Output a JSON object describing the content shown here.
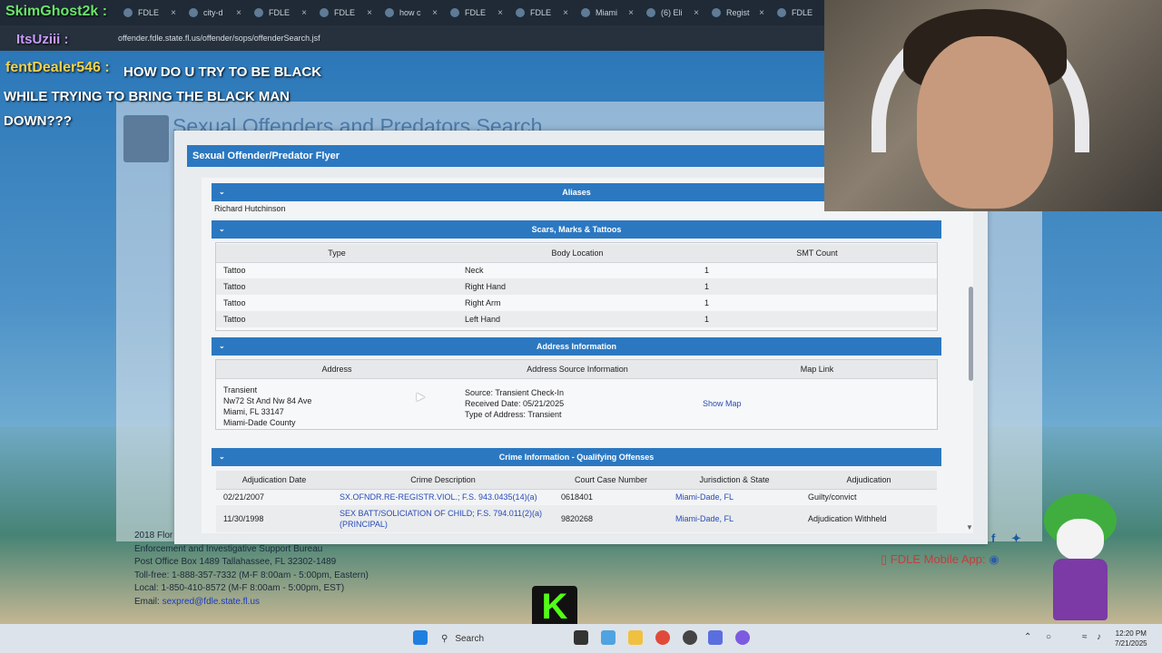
{
  "browser": {
    "tabs": [
      {
        "label": "FDLE"
      },
      {
        "label": "city-d"
      },
      {
        "label": "FDLE"
      },
      {
        "label": "FDLE"
      },
      {
        "label": "how c"
      },
      {
        "label": "FDLE"
      },
      {
        "label": "FDLE"
      },
      {
        "label": "Miami"
      },
      {
        "label": "(6) Eli"
      },
      {
        "label": "Regist"
      },
      {
        "label": "FDLE"
      }
    ],
    "url": "offender.fdle.state.fl.us/offender/sops/offenderSearch.jsf"
  },
  "page": {
    "header_title": "Sexual Offenders and Predators Search"
  },
  "modal": {
    "title": "Sexual Offender/Predator Flyer",
    "aliases": {
      "heading": "Aliases",
      "value": "Richard Hutchinson"
    },
    "smt": {
      "heading": "Scars, Marks & Tattoos",
      "columns": [
        "Type",
        "Body Location",
        "SMT Count"
      ],
      "rows": [
        {
          "type": "Tattoo",
          "location": "Neck",
          "count": "1"
        },
        {
          "type": "Tattoo",
          "location": "Right Hand",
          "count": "1"
        },
        {
          "type": "Tattoo",
          "location": "Right Arm",
          "count": "1"
        },
        {
          "type": "Tattoo",
          "location": "Left Hand",
          "count": "1"
        }
      ]
    },
    "address": {
      "heading": "Address Information",
      "columns": [
        "Address",
        "Address Source Information",
        "Map Link"
      ],
      "address_lines": [
        "Transient",
        "Nw72 St And Nw 84 Ave",
        "Miami, FL 33147",
        "Miami-Dade County"
      ],
      "source_lines": [
        "Source: Transient Check-In",
        "Received Date: 05/21/2025",
        "Type of Address: Transient"
      ],
      "map_link": "Show Map"
    },
    "crime": {
      "heading": "Crime Information - Qualifying Offenses",
      "columns": [
        "Adjudication Date",
        "Crime Description",
        "Court Case Number",
        "Jurisdiction & State",
        "Adjudication"
      ],
      "rows": [
        {
          "date": "02/21/2007",
          "desc": "SX.OFNDR.RE-REGISTR.VIOL.; F.S. 943.0435(14)(a)",
          "desc2": "",
          "case": "0618401",
          "jurisdiction": "Miami-Dade, FL",
          "adjudication": "Guilty/convict"
        },
        {
          "date": "11/30/1998",
          "desc": "SEX BATT/SOLICIATION OF CHILD; F.S. 794.011(2)(a)",
          "desc2": "(PRINCIPAL)",
          "case": "9820268",
          "jurisdiction": "Miami-Dade, FL",
          "adjudication": "Adjudication Withheld"
        }
      ]
    }
  },
  "footer": {
    "lines": [
      "2018 Flor",
      "Enforcement and Investigative Support Bureau",
      "Post Office Box 1489 Tallahassee, FL 32302-1489",
      "Toll-free: 1-888-357-7332 (M-F 8:00am - 5:00pm, Eastern)",
      "Local: 1-850-410-8572 (M-F 8:00am - 5:00pm, EST)"
    ],
    "email_label": "Email:",
    "email": "sexpred@fdle.state.fl.us",
    "mobile_app": "FDLE Mobile App:"
  },
  "overlay": {
    "user1": "SkimGhost2k :",
    "user2": "ItsUziii :",
    "user3": "fentDealer546 :",
    "message_l1": "HOW DO U TRY TO BE BLACK",
    "message_l2": "WHILE TRYING TO BRING THE BLACK MAN",
    "message_l3": "DOWN???",
    "k_badge": "K"
  },
  "taskbar": {
    "search": "Search",
    "time": "12:20 PM",
    "date": "7/21/2025"
  },
  "colors": {
    "section_blue": "#2b78c1",
    "link_blue": "#2a4bb6",
    "kick_green": "#53fc18"
  }
}
